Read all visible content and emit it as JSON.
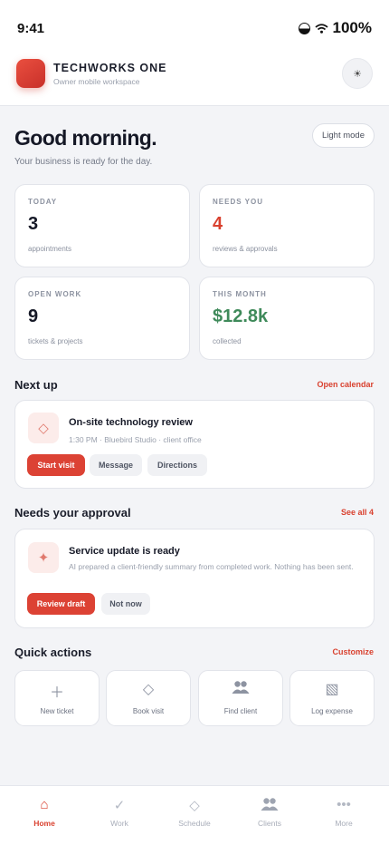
{
  "status_bar": {
    "time": "9:41",
    "battery": "100%"
  },
  "header": {
    "app_name": "TECHWORKS ONE",
    "subtitle": "Owner mobile workspace",
    "theme_icon": "sun-icon"
  },
  "greeting": {
    "title": "Good morning.",
    "subtitle": "Your business is ready for the day.",
    "mode_button": "Light mode"
  },
  "stats": [
    {
      "label": "TODAY",
      "value": "3",
      "caption": "appointments",
      "color": "#161927"
    },
    {
      "label": "NEEDS YOU",
      "value": "4",
      "caption": "reviews & approvals",
      "color": "#d9412f"
    },
    {
      "label": "OPEN WORK",
      "value": "9",
      "caption": "tickets & projects",
      "color": "#161927"
    },
    {
      "label": "THIS MONTH",
      "value": "$12.8k",
      "caption": "collected",
      "color": "#3f8a5a"
    }
  ],
  "next_up": {
    "section_title": "Next up",
    "link": "Open calendar",
    "title": "On-site technology review",
    "detail": "1:30 PM · Bluebird Studio · client office",
    "actions": [
      "Start visit",
      "Message",
      "Directions"
    ]
  },
  "approval": {
    "section_title": "Needs your approval",
    "link": "See all 4",
    "title": "Service update is ready",
    "detail": "AI prepared a client-friendly summary from completed work. Nothing has been sent.",
    "actions": [
      "Review draft",
      "Not now"
    ]
  },
  "quick_actions": {
    "section_title": "Quick actions",
    "link": "Customize",
    "items": [
      {
        "label": "New ticket",
        "icon": "plus-icon"
      },
      {
        "label": "Book visit",
        "icon": "diamond-icon"
      },
      {
        "label": "Find client",
        "icon": "people-icon"
      },
      {
        "label": "Log expense",
        "icon": "receipt-icon"
      }
    ]
  },
  "tabbar": {
    "items": [
      {
        "label": "Home",
        "icon": "home-icon",
        "active": true
      },
      {
        "label": "Work",
        "icon": "check-icon",
        "active": false
      },
      {
        "label": "Schedule",
        "icon": "diamond-icon",
        "active": false
      },
      {
        "label": "Clients",
        "icon": "people-icon",
        "active": false
      },
      {
        "label": "More",
        "icon": "dots-icon",
        "active": false
      }
    ]
  },
  "colors": {
    "accent": "#d9412f",
    "positive": "#3f8a5a",
    "background": "#f3f4f7"
  }
}
